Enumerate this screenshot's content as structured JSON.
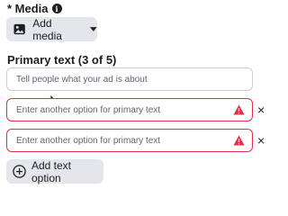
{
  "media": {
    "label": "* Media",
    "info_icon": "i",
    "add_button": {
      "label": "Add media",
      "icon": "image-icon",
      "caret": "dropdown-caret-icon"
    }
  },
  "primary_text": {
    "label": "Primary text (3 of 5)",
    "fields": [
      {
        "placeholder": "Tell people what your ad is about",
        "error": false
      },
      {
        "placeholder": "Enter another option for primary text",
        "error": true,
        "remove": "×"
      },
      {
        "placeholder": "Enter another option for primary text",
        "error": true,
        "remove": "×"
      }
    ],
    "add_button": {
      "label": "Add text option",
      "icon": "plus-circle-icon"
    }
  },
  "colors": {
    "error": "#e0314a",
    "button_bg": "#e4e6eb",
    "border": "#ced0d4"
  }
}
